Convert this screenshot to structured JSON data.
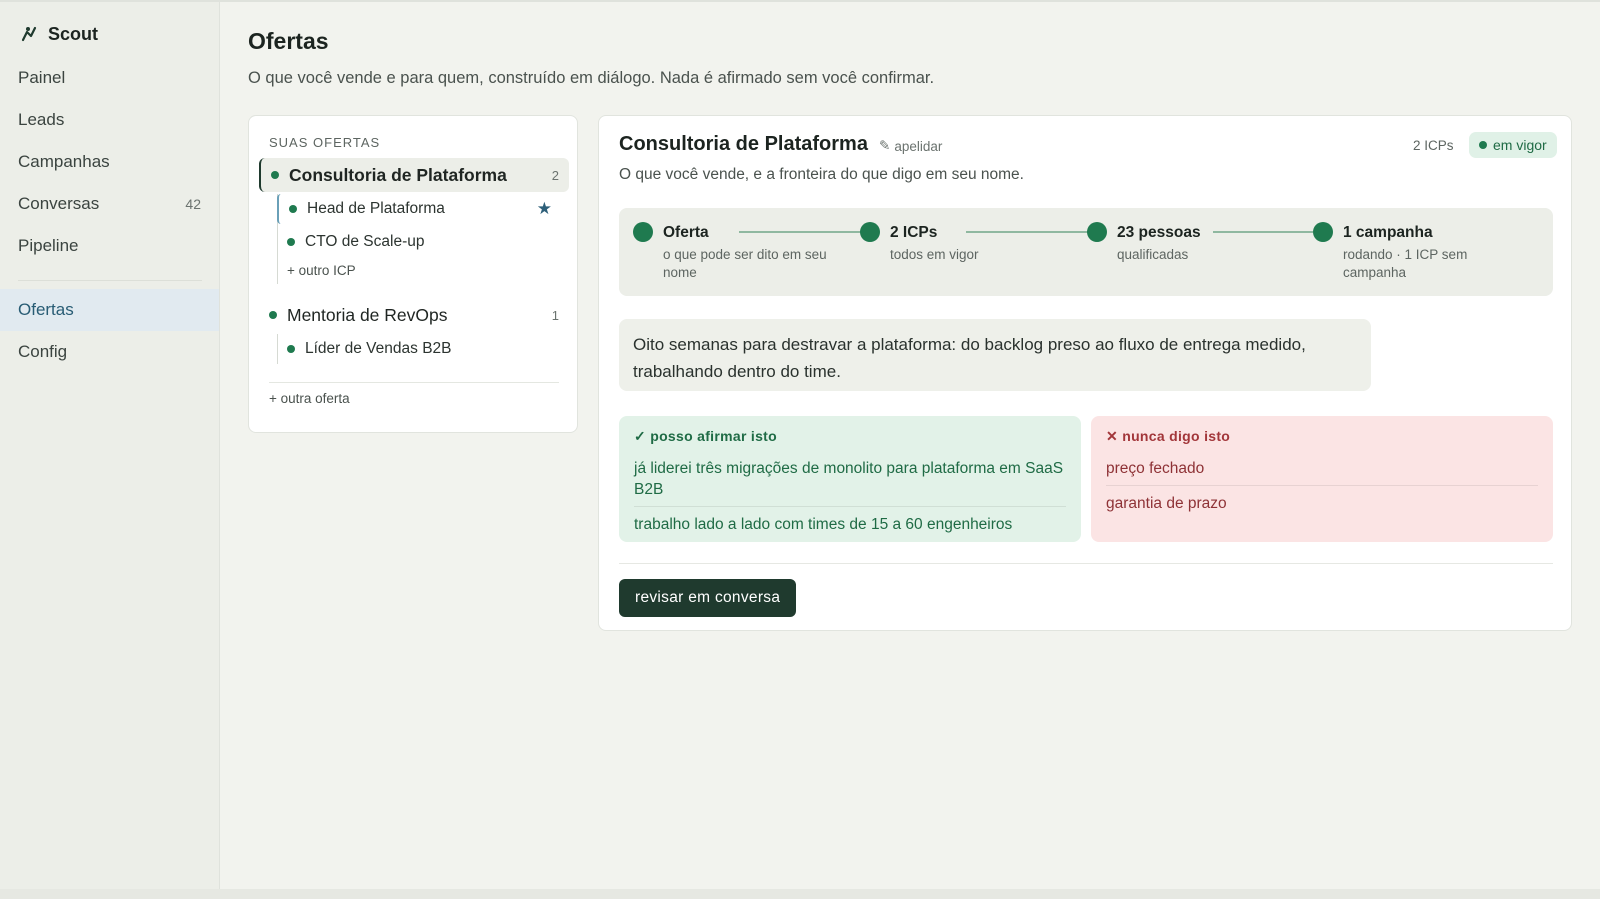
{
  "app": {
    "name": "Scout"
  },
  "sidebar": {
    "items": [
      {
        "label": "Painel",
        "count": ""
      },
      {
        "label": "Leads",
        "count": ""
      },
      {
        "label": "Campanhas",
        "count": ""
      },
      {
        "label": "Conversas",
        "count": "42"
      },
      {
        "label": "Pipeline",
        "count": ""
      },
      {
        "label": "Ofertas",
        "count": "",
        "active": true
      },
      {
        "label": "Config",
        "count": ""
      }
    ]
  },
  "page": {
    "title": "Ofertas",
    "subtitle": "O que você vende e para quem, construído em diálogo. Nada é afirmado sem você confirmar."
  },
  "offers_panel": {
    "section_label": "SUAS OFERTAS",
    "offers": [
      {
        "name": "Consultoria de Plataforma",
        "count": "2",
        "icps": [
          "Head de Plataforma",
          "CTO de Scale-up"
        ],
        "add_icp": "+ outro ICP"
      },
      {
        "name": "Mentoria de RevOps",
        "count": "1",
        "icps": [
          "Líder de Vendas B2B"
        ]
      }
    ],
    "add_offer": "+ outra oferta"
  },
  "detail": {
    "title": "Consultoria de Plataforma",
    "rename": "apelidar",
    "icp_count": "2 ICPs",
    "status": "em vigor",
    "subtitle": "O que você vende, e a fronteira do que digo em seu nome.",
    "steps": [
      {
        "title": "Oferta",
        "desc": "o que pode ser dito em seu nome"
      },
      {
        "title": "2 ICPs",
        "desc": "todos em vigor"
      },
      {
        "title": "23 pessoas",
        "desc": "qualificadas"
      },
      {
        "title": "1 campanha",
        "desc": "rodando · 1 ICP sem campanha"
      }
    ],
    "pitch": "Oito semanas para destravar a plataforma: do backlog preso ao fluxo de entrega medido, trabalhando dentro do time.",
    "can_claim": {
      "heading": "✓ posso afirmar isto",
      "items": [
        "já liderei três migrações de monolito para plataforma em SaaS B2B",
        "trabalho lado a lado com times de 15 a 60 engenheiros"
      ]
    },
    "never_claim": {
      "heading": "✕ nunca digo isto",
      "items": [
        "preço fechado",
        "garantia de prazo"
      ]
    },
    "review_button": "revisar em conversa"
  },
  "colors": {
    "accent_green": "#1f7a4f",
    "button_dark": "#1f3a2e",
    "active_nav": "#285c74",
    "danger": "#a2363a"
  }
}
